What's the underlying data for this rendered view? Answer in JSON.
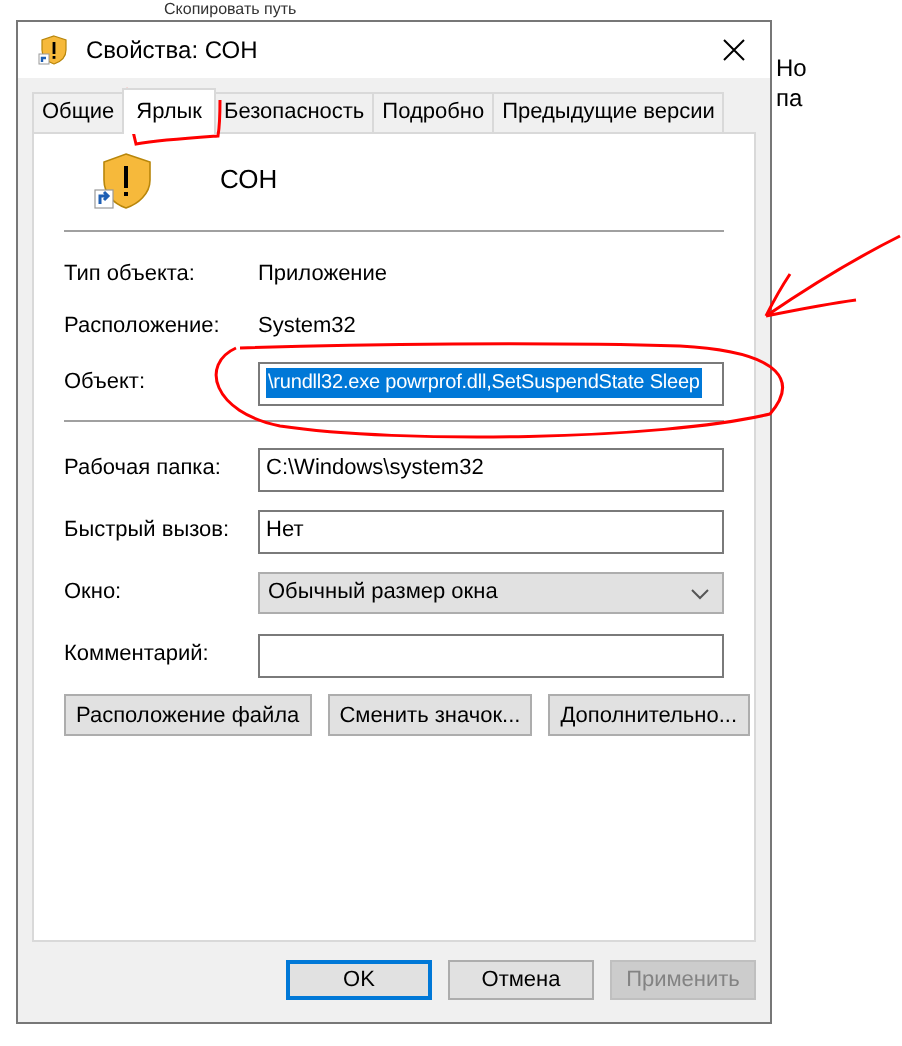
{
  "background": {
    "texts": [
      "Скопировать путь",
      "Но",
      "па"
    ]
  },
  "window": {
    "title": "Свойства: СОН"
  },
  "tabs": [
    {
      "label": "Общие",
      "selected": false
    },
    {
      "label": "Ярлык",
      "selected": true
    },
    {
      "label": "Безопасность",
      "selected": false
    },
    {
      "label": "Подробно",
      "selected": false
    },
    {
      "label": "Предыдущие версии",
      "selected": false
    }
  ],
  "shortcut": {
    "name": "СОН"
  },
  "info": [
    {
      "label": "Тип объекта:",
      "value": "Приложение"
    },
    {
      "label": "Расположение:",
      "value": "System32"
    }
  ],
  "fields": [
    {
      "kind": "input",
      "label": "Объект:",
      "value": "\\rundll32.exe powrprof.dll,SetSuspendState Sleep",
      "text_selected": true,
      "divider_after": true
    },
    {
      "kind": "input",
      "label": "Рабочая папка:",
      "value": "C:\\Windows\\system32"
    },
    {
      "kind": "input",
      "label": "Быстрый вызов:",
      "value": "Нет"
    },
    {
      "kind": "select",
      "label": "Окно:",
      "value": "Обычный размер окна"
    },
    {
      "kind": "input",
      "label": "Комментарий:"
    }
  ],
  "action_buttons": [
    "Расположение файла",
    "Сменить значок...",
    "Дополнительно..."
  ],
  "footer_buttons": [
    {
      "label": "OK",
      "default": true,
      "disabled": false
    },
    {
      "label": "Отмена",
      "default": false,
      "disabled": false
    },
    {
      "label": "Применить",
      "default": false,
      "disabled": true
    }
  ]
}
